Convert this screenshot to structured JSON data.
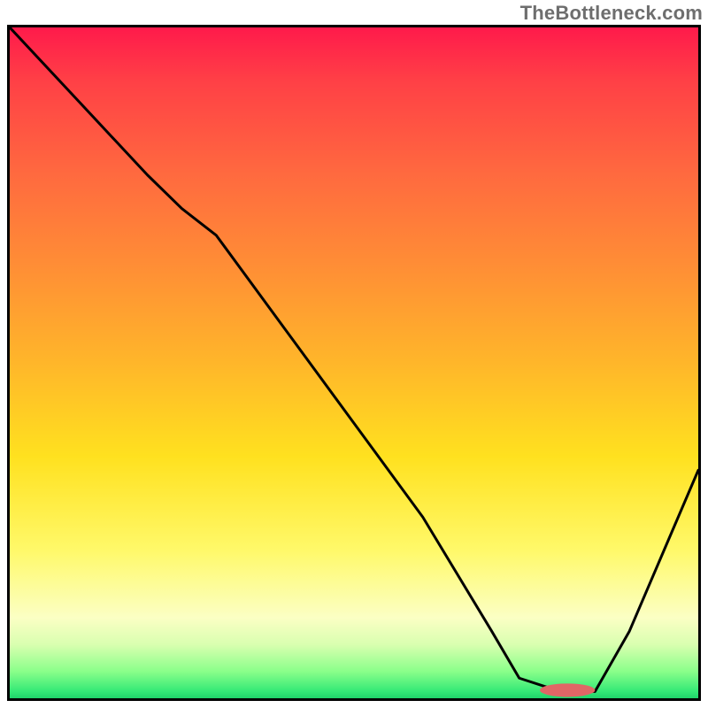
{
  "watermark": "TheBottleneck.com",
  "chart_data": {
    "type": "line",
    "title": "",
    "xlabel": "",
    "ylabel": "",
    "xlim": [
      0,
      100
    ],
    "ylim": [
      0,
      100
    ],
    "grid": false,
    "legend": false,
    "background_gradient": {
      "top": "#ff1a4b",
      "mid_upper": "#ff8f35",
      "mid": "#ffe11f",
      "mid_lower": "#fbffc4",
      "bottom": "#1fd36a"
    },
    "series": [
      {
        "name": "bottleneck-curve",
        "x": [
          0,
          10,
          20,
          25,
          30,
          40,
          50,
          60,
          70,
          74,
          80,
          85,
          90,
          95,
          100
        ],
        "y": [
          100,
          89,
          78,
          73,
          69,
          55,
          41,
          27,
          10,
          3,
          1,
          1,
          10,
          22,
          34
        ]
      }
    ],
    "marker": {
      "name": "optimal-range",
      "x_start": 77,
      "x_end": 85,
      "y": 1,
      "color": "#e06666"
    }
  }
}
